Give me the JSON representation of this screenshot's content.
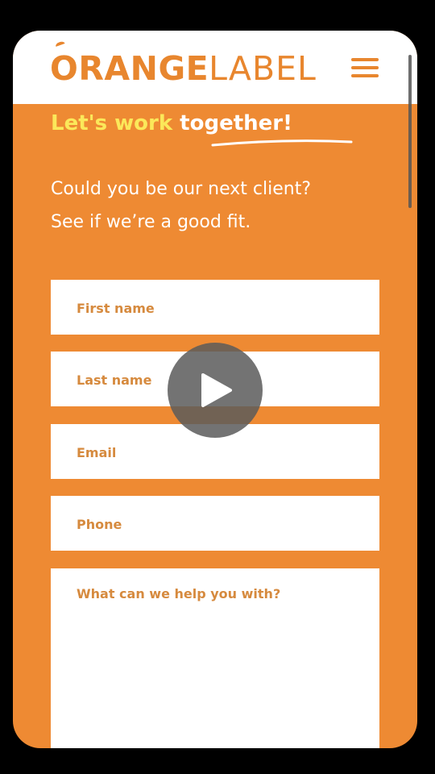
{
  "header": {
    "logo_bold": "ORANGE",
    "logo_light": "LABEL",
    "menu_icon": "hamburger-menu-icon"
  },
  "hero": {
    "headline_part1": "Let's work ",
    "headline_part2": "together!",
    "intro_line1": "Could you be our next client?",
    "intro_line2": "See if we’re a good fit."
  },
  "form": {
    "first_name": "First name",
    "last_name": "Last name",
    "email": "Email",
    "phone": "Phone",
    "message": "What can we help you with?"
  },
  "overlay": {
    "play_icon": "play-icon"
  },
  "colors": {
    "brand_orange": "#ee8a33",
    "logo_orange": "#e8862e",
    "headline_yellow": "#fbe85a",
    "field_label": "#d68a3e"
  }
}
